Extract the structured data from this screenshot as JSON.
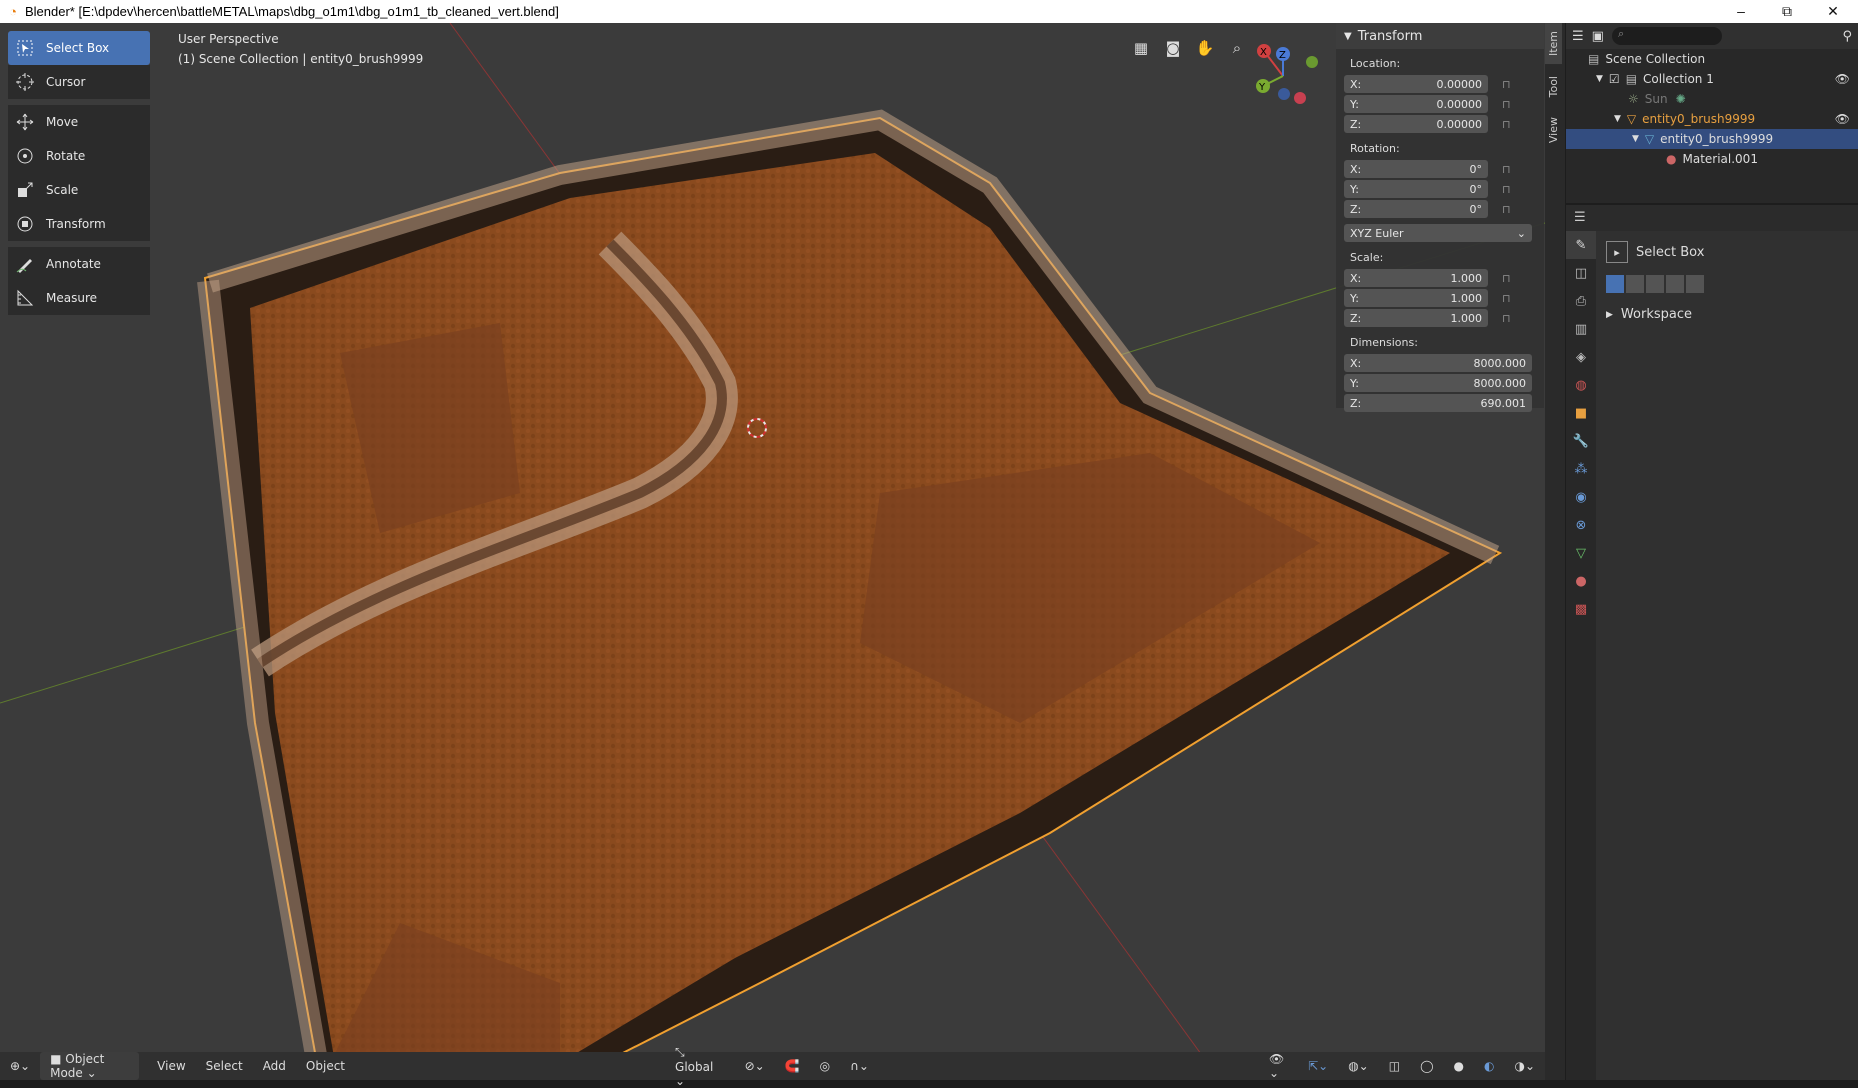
{
  "titlebar": {
    "title": "Blender* [E:\\dpdev\\hercen\\battleMETAL\\maps\\dbg_o1m1\\dbg_o1m1_tb_cleaned_vert.blend]",
    "minimize": "–",
    "maximize": "⧉",
    "close": "✕"
  },
  "viewport": {
    "perspective": "User Perspective",
    "context": "(1) Scene Collection | entity0_brush9999"
  },
  "toolbar": {
    "tools": [
      {
        "label": "Select Box",
        "icon": "select-box-icon",
        "active": true
      },
      {
        "label": "Cursor",
        "icon": "cursor-icon"
      },
      {
        "label": "Move",
        "icon": "move-icon"
      },
      {
        "label": "Rotate",
        "icon": "rotate-icon"
      },
      {
        "label": "Scale",
        "icon": "scale-icon"
      },
      {
        "label": "Transform",
        "icon": "transform-icon"
      },
      {
        "label": "Annotate",
        "icon": "annotate-icon"
      },
      {
        "label": "Measure",
        "icon": "measure-icon"
      }
    ]
  },
  "gizmo": {
    "x": "X",
    "y": "Y",
    "z": "Z"
  },
  "npanel": {
    "header": "Transform",
    "location_label": "Location:",
    "location": [
      {
        "axis": "X:",
        "value": "0.00000"
      },
      {
        "axis": "Y:",
        "value": "0.00000"
      },
      {
        "axis": "Z:",
        "value": "0.00000"
      }
    ],
    "rotation_label": "Rotation:",
    "rotation": [
      {
        "axis": "X:",
        "value": "0°"
      },
      {
        "axis": "Y:",
        "value": "0°"
      },
      {
        "axis": "Z:",
        "value": "0°"
      }
    ],
    "rotation_mode": "XYZ Euler",
    "scale_label": "Scale:",
    "scale": [
      {
        "axis": "X:",
        "value": "1.000"
      },
      {
        "axis": "Y:",
        "value": "1.000"
      },
      {
        "axis": "Z:",
        "value": "1.000"
      }
    ],
    "dimensions_label": "Dimensions:",
    "dimensions": [
      {
        "axis": "X:",
        "value": "8000.000"
      },
      {
        "axis": "Y:",
        "value": "8000.000"
      },
      {
        "axis": "Z:",
        "value": "690.001"
      }
    ]
  },
  "side_tabs": [
    "Item",
    "Tool",
    "View"
  ],
  "outliner": {
    "items": [
      {
        "label": "Scene Collection",
        "indent": 0
      },
      {
        "label": "Collection 1",
        "indent": 1
      },
      {
        "label": "Sun",
        "indent": 2,
        "dim": true
      },
      {
        "label": "entity0_brush9999",
        "indent": 2,
        "highlight": true
      },
      {
        "label": "entity0_brush9999",
        "indent": 3,
        "selected": true
      },
      {
        "label": "Material.001",
        "indent": 4
      }
    ]
  },
  "properties": {
    "tool_name": "Select Box",
    "workspace": "Workspace"
  },
  "bottombar": {
    "mode": "Object Mode",
    "menus": [
      "View",
      "Select",
      "Add",
      "Object"
    ],
    "orientation": "Global"
  },
  "colors": {
    "accent": "#4772b3",
    "selection_outline": "#f0a030",
    "terrain": "#8a4a1e"
  }
}
